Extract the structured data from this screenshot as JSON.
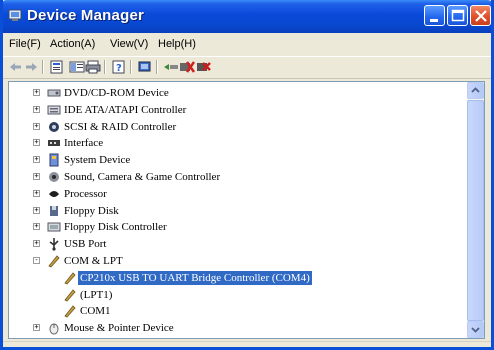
{
  "window": {
    "title": "Device Manager"
  },
  "menu": [
    {
      "label": "File(F)"
    },
    {
      "label": "Action(A)"
    },
    {
      "label": "View(V)"
    },
    {
      "label": "Help(H)"
    }
  ],
  "toolbar": {
    "icons": [
      "back-icon",
      "forward-icon",
      "properties-icon",
      "view-icon",
      "print-icon",
      "help-icon",
      "scan-hardware-icon",
      "update-driver-icon",
      "uninstall-icon",
      "disable-icon"
    ]
  },
  "tree": {
    "items": [
      {
        "label": "DVD/CD-ROM Device",
        "icon": "dvd-drive-icon",
        "expander": "+"
      },
      {
        "label": "IDE ATA/ATAPI Controller",
        "icon": "ide-controller-icon",
        "expander": "+"
      },
      {
        "label": "SCSI & RAID Controller",
        "icon": "scsi-controller-icon",
        "expander": "+"
      },
      {
        "label": "Interface",
        "icon": "interface-icon",
        "expander": "+"
      },
      {
        "label": "System Device",
        "icon": "system-device-icon",
        "expander": "+"
      },
      {
        "label": "Sound, Camera & Game Controller",
        "icon": "sound-icon",
        "expander": "+"
      },
      {
        "label": "Processor",
        "icon": "processor-icon",
        "expander": "+"
      },
      {
        "label": "Floppy Disk",
        "icon": "floppy-disk-icon",
        "expander": "+"
      },
      {
        "label": "Floppy Disk Controller",
        "icon": "floppy-controller-icon",
        "expander": "+"
      },
      {
        "label": "USB Port",
        "icon": "usb-icon",
        "expander": "+"
      },
      {
        "label": "COM & LPT",
        "icon": "port-icon",
        "expander": "−"
      },
      {
        "label": "CP210x USB TO UART Bridge Controller (COM4)",
        "icon": "port-icon",
        "selected": true
      },
      {
        "label": "(LPT1)",
        "icon": "port-icon"
      },
      {
        "label": "COM1",
        "icon": "port-icon"
      },
      {
        "label": "Mouse & Pointer Device",
        "icon": "mouse-icon",
        "expander": "+"
      }
    ]
  },
  "colors": {
    "titlebar": "#0a4ad9",
    "selection": "#316ac5",
    "chrome": "#ece9d8"
  }
}
